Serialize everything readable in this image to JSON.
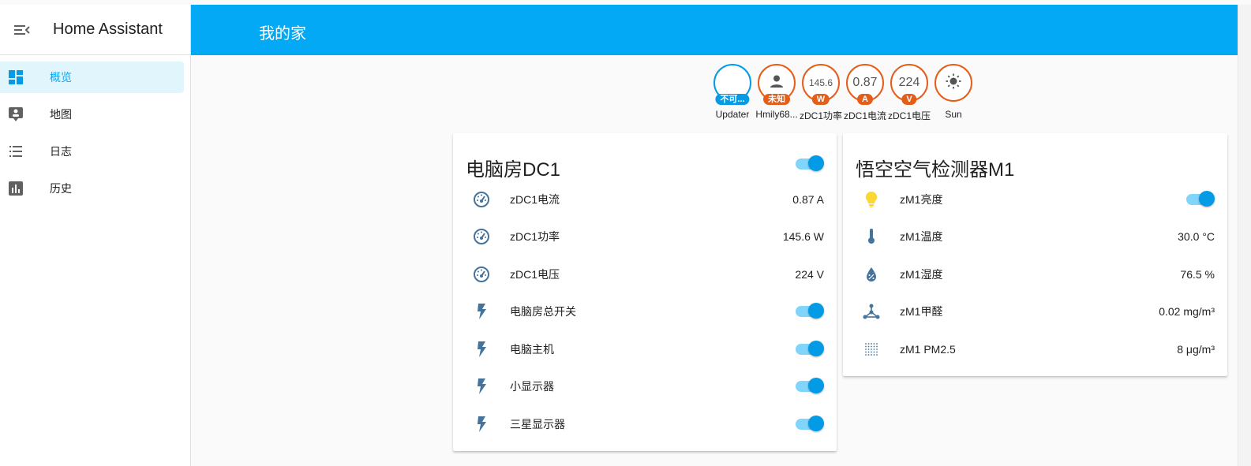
{
  "app_title": "Home Assistant",
  "sidebar": {
    "items": [
      {
        "label": "概览",
        "icon": "dashboard-icon",
        "active": true
      },
      {
        "label": "地图",
        "icon": "map-account-icon",
        "active": false
      },
      {
        "label": "日志",
        "icon": "logbook-list-icon",
        "active": false
      },
      {
        "label": "历史",
        "icon": "history-chart-icon",
        "active": false
      }
    ]
  },
  "header": {
    "title": "我的家"
  },
  "badges": [
    {
      "name": "Updater",
      "value": "",
      "tag": "不可...",
      "color": "#039be5"
    },
    {
      "name": "Hmily68...",
      "value": "",
      "tag": "未知",
      "icon": "account-icon",
      "color": "#e45e1a"
    },
    {
      "name": "zDC1功率",
      "value": "145.6",
      "tag": "W",
      "color": "#e45e1a"
    },
    {
      "name": "zDC1电流",
      "value": "0.87",
      "tag": "A",
      "color": "#e45e1a"
    },
    {
      "name": "zDC1电压",
      "value": "224",
      "tag": "V",
      "color": "#e45e1a"
    },
    {
      "name": "Sun",
      "value": "",
      "icon": "sun-icon",
      "color": "#e45e1a"
    }
  ],
  "cards": [
    {
      "title": "电脑房DC1",
      "header_toggle": true,
      "rows": [
        {
          "name": "zDC1电流",
          "value": "0.87 A",
          "icon": "gauge-icon"
        },
        {
          "name": "zDC1功率",
          "value": "145.6 W",
          "icon": "gauge-icon"
        },
        {
          "name": "zDC1电压",
          "value": "224 V",
          "icon": "gauge-icon"
        },
        {
          "name": "电脑房总开关",
          "toggle": true,
          "icon": "flash-icon"
        },
        {
          "name": "电脑主机",
          "toggle": true,
          "icon": "flash-icon"
        },
        {
          "name": "小显示器",
          "toggle": true,
          "icon": "flash-icon"
        },
        {
          "name": "三星显示器",
          "toggle": true,
          "icon": "flash-icon"
        }
      ]
    },
    {
      "title": "悟空空气检测器M1",
      "rows": [
        {
          "name": "zM1亮度",
          "toggle": true,
          "icon": "lightbulb-icon",
          "icon_color": "#fdd835"
        },
        {
          "name": "zM1温度",
          "value": "30.0 °C",
          "icon": "thermometer-icon"
        },
        {
          "name": "zM1湿度",
          "value": "76.5 %",
          "icon": "water-percent-icon"
        },
        {
          "name": "zM1甲醛",
          "value": "0.02 mg/m³",
          "icon": "molecule-icon"
        },
        {
          "name": "zM1 PM2.5",
          "value": "8 μg/m³",
          "icon": "dots-grid-icon"
        }
      ]
    }
  ],
  "colors": {
    "primary": "#03a9f4",
    "accent": "#e45e1a",
    "icon": "#44739e"
  }
}
